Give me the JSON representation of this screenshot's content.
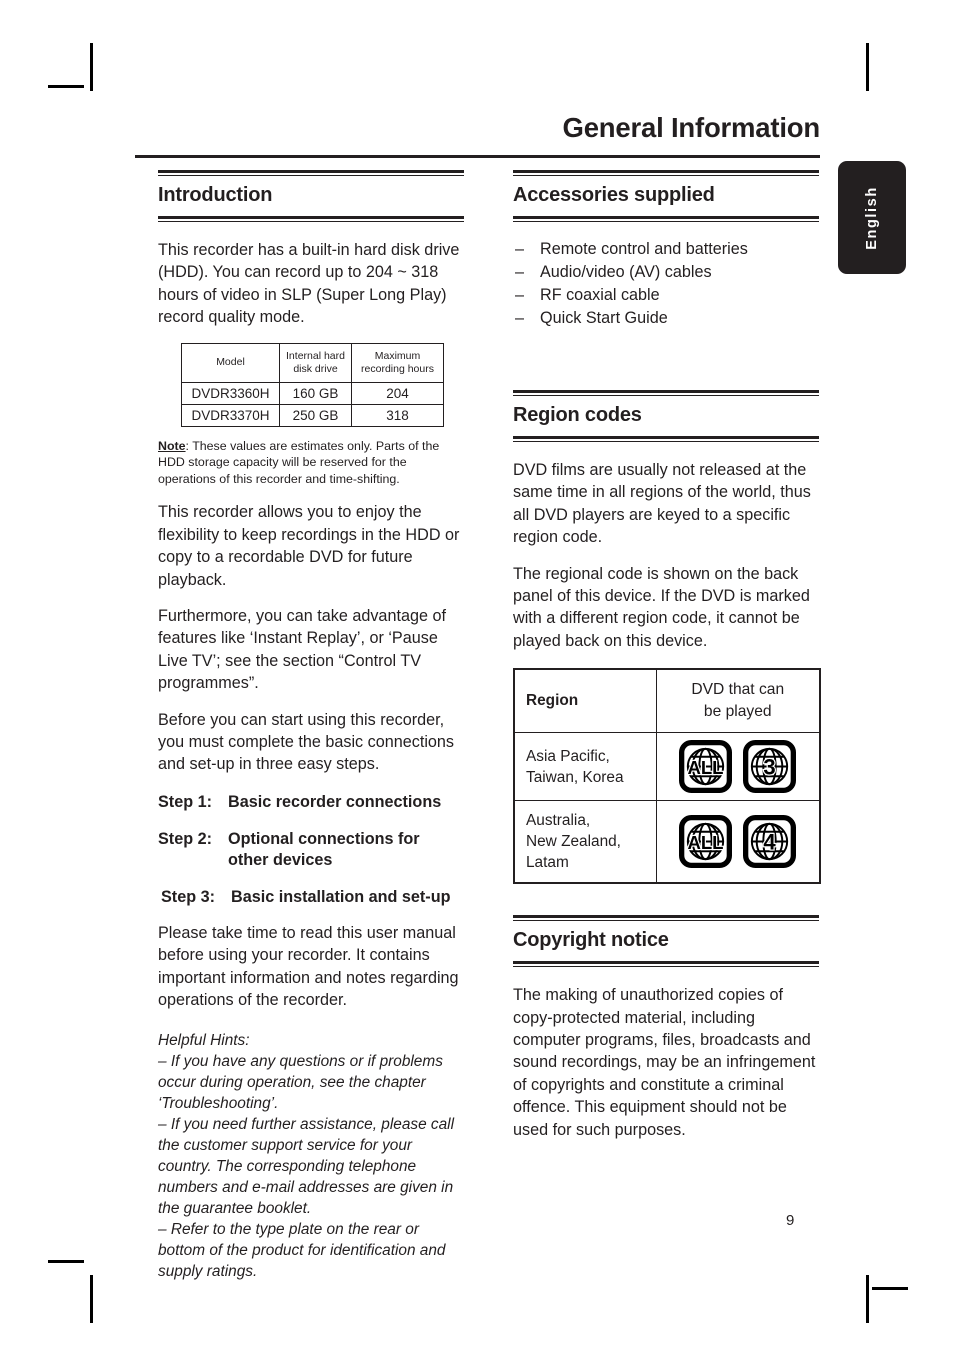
{
  "page": {
    "title": "General Information",
    "number": "9",
    "language_tab": "English"
  },
  "left_column": {
    "introduction": {
      "heading": "Introduction",
      "para1": "This recorder has a built-in hard disk drive (HDD). You can record up to 204 ~ 318 hours of video in SLP (Super Long Play) record quality mode.",
      "table": {
        "headers": [
          "Model",
          "Internal hard disk drive",
          "Maximum recording hours"
        ],
        "headers_lines": [
          [
            "Model"
          ],
          [
            "Internal hard",
            "disk drive"
          ],
          [
            "Maximum",
            "recording hours"
          ]
        ],
        "rows": [
          [
            "DVDR3360H",
            "160 GB",
            "204"
          ],
          [
            "DVDR3370H",
            "250 GB",
            "318"
          ]
        ]
      },
      "note_label": "Note",
      "note_text": ": These values are estimates only. Parts of the HDD storage capacity will be reserved for the operations of this recorder and time-shifting.",
      "para2": "This recorder allows you to enjoy the flexibility to keep recordings in the HDD or copy to a recordable DVD for future playback.",
      "para3": "Furthermore, you can take advantage of features like ‘Instant Replay’, or ‘Pause Live TV’; see the section “Control TV programmes”.",
      "para4": "Before you can start using this recorder, you must complete the basic connections and set-up in three easy steps.",
      "steps": [
        {
          "label": "Step 1:",
          "text": "Basic recorder connections"
        },
        {
          "label": "Step 2:",
          "text": "Optional connections for other devices"
        },
        {
          "label": "Step 3:",
          "text": "Basic installation and set-up"
        }
      ],
      "para5": "Please take time to read this user manual before using your recorder. It contains important information and notes regarding operations of the recorder.",
      "hints_title": "Helpful Hints:",
      "hints": [
        "–  If you have any questions or if problems occur during operation, see the chapter ‘Troubleshooting’.",
        "–  If you need further assistance, please call the customer support service for your country. The corresponding telephone numbers and e-mail addresses are given in the guarantee booklet.",
        "–  Refer to the type plate on the rear or bottom of the product for identification and supply ratings."
      ]
    }
  },
  "right_column": {
    "accessories": {
      "heading": "Accessories supplied",
      "items": [
        "Remote control and batteries",
        "Audio/video (AV) cables",
        "RF coaxial cable",
        "Quick Start Guide"
      ],
      "bullet": "–"
    },
    "region_codes": {
      "heading": "Region codes",
      "para1": "DVD films are usually not released at the same time in all regions of the world, thus all DVD players are keyed to a specific region code.",
      "para2": "The regional code is shown on the back panel of this device. If the DVD is marked with a different region code, it cannot be played back on this device.",
      "table": {
        "header_region": "Region",
        "header_dvd_lines": [
          "DVD that can",
          "be played"
        ],
        "rows": [
          {
            "region_lines": [
              "Asia Pacific,",
              "Taiwan, Korea"
            ],
            "icons": [
              "ALL",
              "3"
            ]
          },
          {
            "region_lines": [
              "Australia,",
              "New Zealand,",
              "Latam"
            ],
            "icons": [
              "ALL",
              "4"
            ]
          }
        ]
      }
    },
    "copyright": {
      "heading": "Copyright notice",
      "para1": "The making of unauthorized copies of copy-protected material, including computer programs, files, broadcasts and sound recordings, may be an infringement of copyrights and constitute a criminal offence. This equipment should not be used for such purposes."
    }
  },
  "colors": {
    "ink": "#231f20",
    "paper": "#ffffff"
  }
}
